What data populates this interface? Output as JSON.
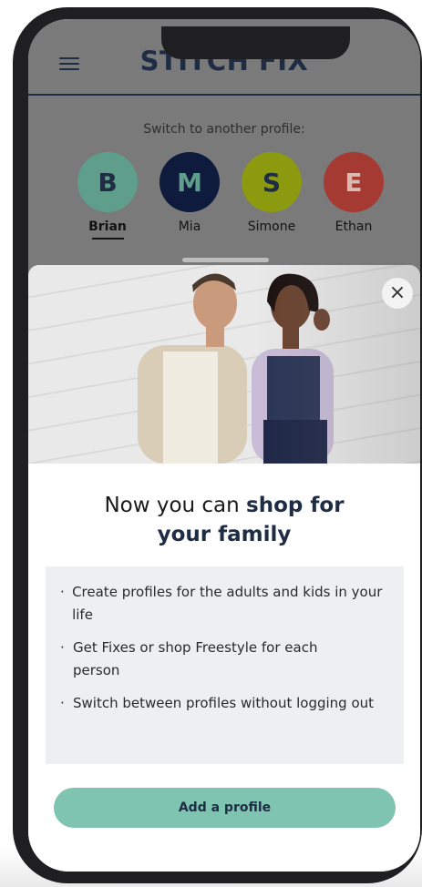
{
  "app": {
    "logo_text": "STĪTCH FĪX"
  },
  "header": {
    "menu_icon": "hamburger-menu-icon"
  },
  "profiles": {
    "label": "Switch to another profile:",
    "items": [
      {
        "initial": "B",
        "name": "Brian",
        "color": "#5e9e8b",
        "initial_color": "#1e2c44",
        "active": true
      },
      {
        "initial": "M",
        "name": "Mia",
        "color": "#0f1b3d",
        "initial_color": "#5e9e8b",
        "active": false
      },
      {
        "initial": "S",
        "name": "Simone",
        "color": "#8c9a10",
        "initial_color": "#1e2c44",
        "active": false
      },
      {
        "initial": "E",
        "name": "Ethan",
        "color": "#a53a33",
        "initial_color": "#d9b9b0",
        "active": false
      }
    ]
  },
  "sheet": {
    "close_icon": "close-icon",
    "title_regular": "Now you can ",
    "title_bold_1": "shop for",
    "title_bold_2": "your family",
    "benefits": [
      "Create profiles for the adults and kids in your life",
      "Get Fixes or shop Freestyle for each person",
      "Switch between profiles without logging out"
    ],
    "cta_label": "Add a profile"
  },
  "colors": {
    "brand_navy": "#1e2c44",
    "cta_green": "#7fc4b1",
    "benefits_bg": "#eeeff1"
  }
}
